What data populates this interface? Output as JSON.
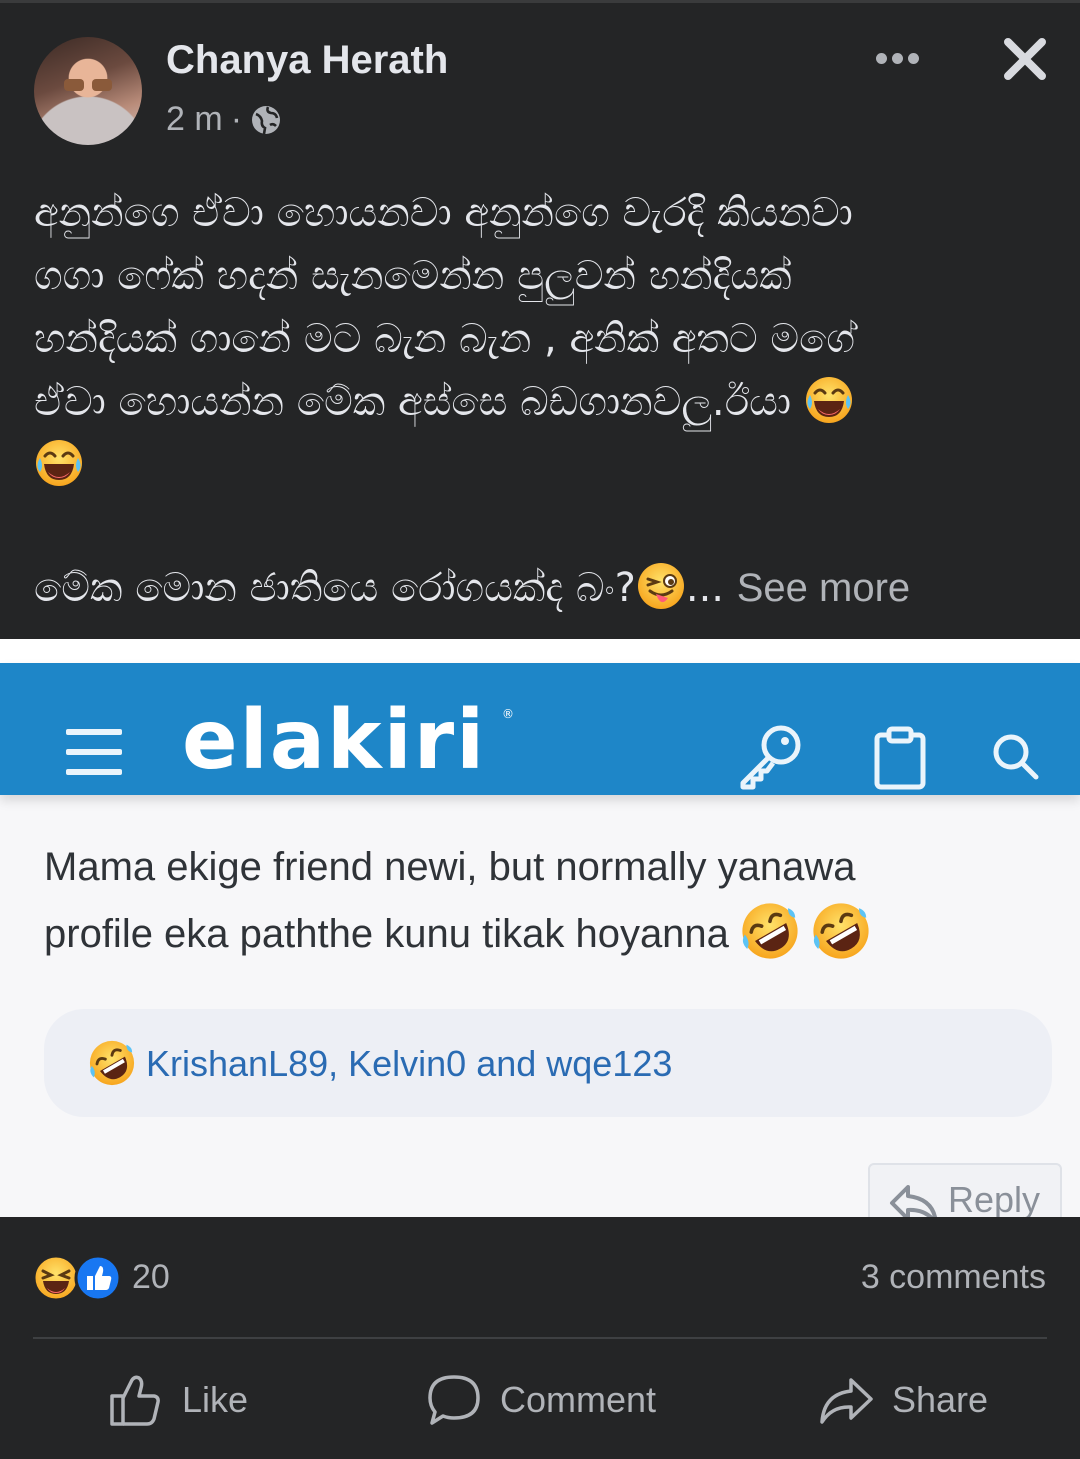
{
  "post": {
    "author": "Chanya Herath",
    "time": "2 m",
    "separator": "·",
    "body_lines": "අනුන්ගෙ ඒවා හොයනවා අනුන්ගෙ වැරදි කියනවා\nගගා ෆේක් හදන් සැනමෙන්න පුලුවන් හන්දියක්\nහන්දියක් ගානේ මට බැන බැන , අනික් අතට මගේ\nඒවා හොයන්න මේක අස්සෙ බඩගානවලු.ඊයා ",
    "body_last": "මේක මොන ජාතියෙ රෝගයක්ද බං?",
    "ellipsis": "...",
    "see_more": "See more"
  },
  "shared_image": {
    "site_logo": "elakiri",
    "registered_mark": "®",
    "comment_line1": "Mama ekige friend newi, but normally yanawa",
    "comment_line2": "profile eka paththe kunu tikak hoyanna",
    "reaction_names": "KrishanL89, Kelvin0 and wqe123",
    "reply_label": "Reply"
  },
  "footer": {
    "reaction_count": "20",
    "comments": "3 comments",
    "like": "Like",
    "comment": "Comment",
    "share": "Share"
  },
  "icons": {
    "more": "more-options-icon",
    "close": "close-icon",
    "audience": "globe-icon",
    "emoji_laugh": "tears-of-joy-emoji",
    "emoji_wink": "winking-tongue-emoji",
    "emoji_rofl": "rolling-laughing-emoji"
  },
  "colors": {
    "background": "#242526",
    "text": "#e4e6eb",
    "muted": "#b0b3b8",
    "elakiri_blue": "#1e86c8",
    "link_blue": "#2a6bb3",
    "like_blue": "#1877f2"
  }
}
